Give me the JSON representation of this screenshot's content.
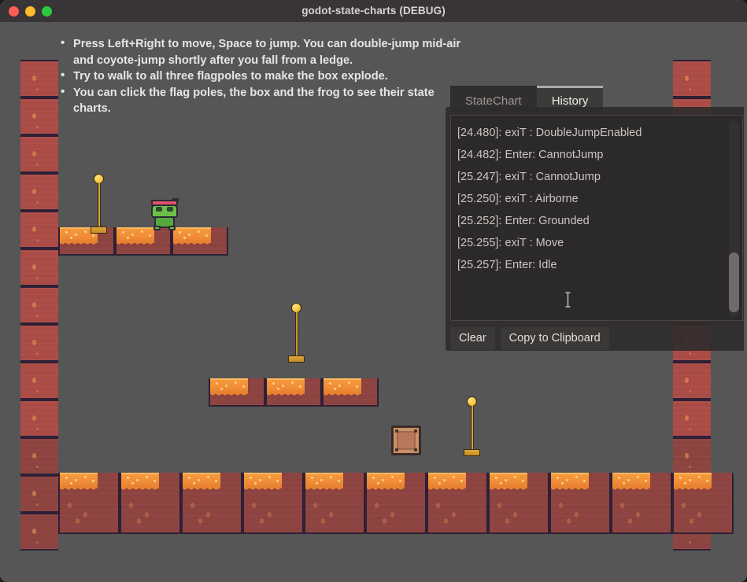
{
  "window": {
    "title": "godot-state-charts (DEBUG)",
    "traffic_lights": [
      {
        "name": "close-button",
        "color": "#fc5f57"
      },
      {
        "name": "minimize-button",
        "color": "#fdbc2e"
      },
      {
        "name": "maximize-button",
        "color": "#2ac93f"
      }
    ]
  },
  "instructions": [
    "Press Left+Right to move, Space to jump. You can double-jump mid-air and coyote-jump shortly after you fall from a ledge.",
    "Try to walk to all three flagpoles to make the box explode.",
    "You can click the flag poles, the box and the frog to see their state charts."
  ],
  "panel": {
    "tabs": [
      {
        "label": "StateChart",
        "active": false
      },
      {
        "label": "History",
        "active": true
      }
    ],
    "history": [
      "[24.480]: exiT : DoubleJumpEnabled",
      "[24.482]: Enter: CannotJump",
      "[25.247]: exiT : CannotJump",
      "[25.250]: exiT : Airborne",
      "[25.252]: Enter: Grounded",
      "[25.255]: exiT : Move",
      "[25.257]: Enter: Idle"
    ],
    "buttons": [
      {
        "label": "Clear",
        "name": "clear-button"
      },
      {
        "label": "Copy to Clipboard",
        "name": "copy-to-clipboard-button"
      }
    ]
  },
  "game": {
    "colors": {
      "background": "#565656",
      "brick": "#ab4b46",
      "brick_dim": "#8d4340",
      "lava": "#f08c36",
      "frog_body": "#6cc04a",
      "frog_band": "#e0526a",
      "pole_gold": "#d9a93a",
      "crate_wood": "#c89168"
    },
    "entities": {
      "frog": {
        "name": "frog-character"
      },
      "crate": {
        "name": "explosive-box"
      },
      "flagpoles": 3
    }
  }
}
